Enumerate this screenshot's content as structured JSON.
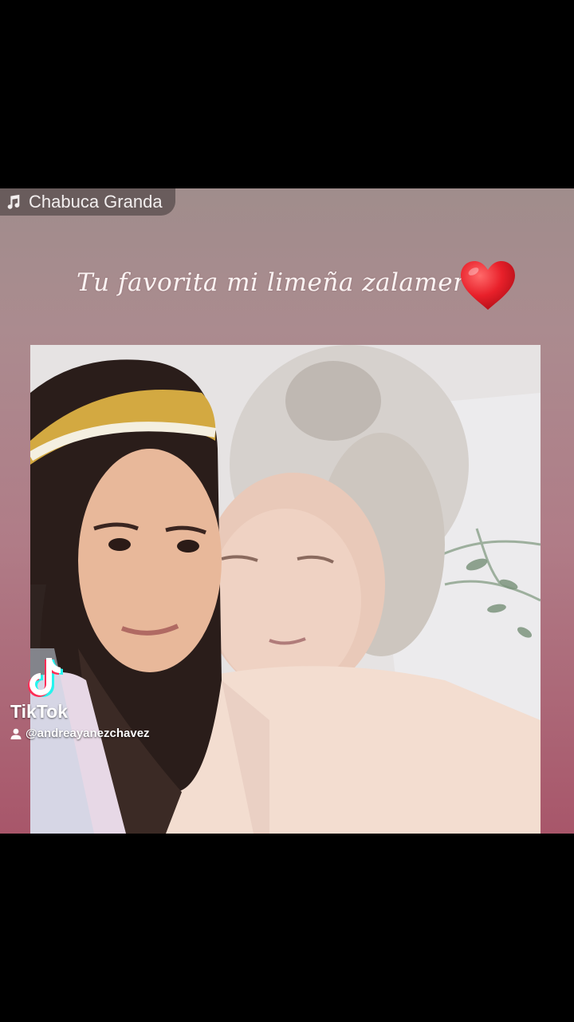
{
  "music": {
    "icon": "music-note-icon",
    "title": "Chabuca Granda"
  },
  "caption": {
    "text": "Tu favorita  mi limeña zalamera",
    "emoji": "red-heart-icon",
    "emoji_color": "#e8202a"
  },
  "photo": {
    "description_icon": "photo"
  },
  "watermark": {
    "logo": "tiktok-logo-icon",
    "brand": "TikTok",
    "user_icon": "user-icon",
    "handle": "@andreayanezchavez"
  },
  "colors": {
    "background": "#000000",
    "story_top": "#a08d8c",
    "story_bottom": "#a8566a",
    "text_light": "#fbf3f3"
  }
}
